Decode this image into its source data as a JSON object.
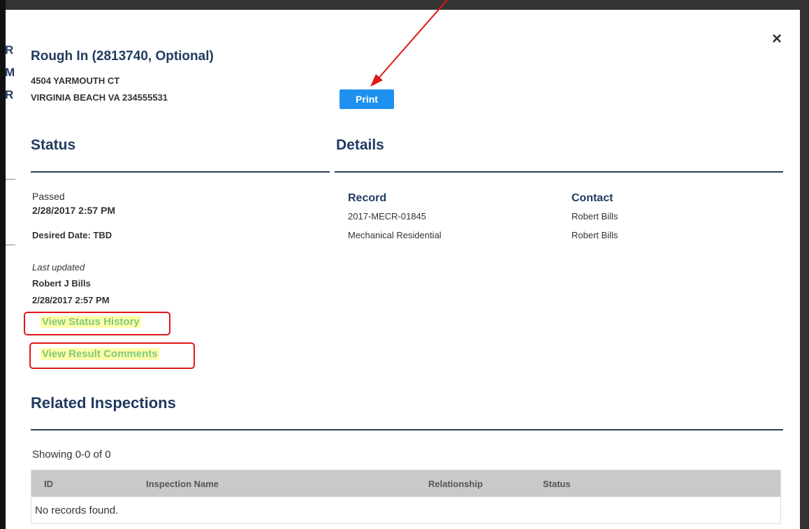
{
  "modal": {
    "title": "Rough In (2813740, Optional)",
    "address_line1": "4504 YARMOUTH CT",
    "address_line2": "VIRGINIA BEACH VA 234555531",
    "print_label": "Print",
    "close_symbol": "×"
  },
  "status": {
    "heading": "Status",
    "result": "Passed",
    "datetime": "2/28/2017 2:57 PM",
    "desired_date": "Desired Date: TBD",
    "last_updated_label": "Last updated",
    "updated_by": "Robert J Bills",
    "updated_datetime": "2/28/2017 2:57 PM",
    "view_status_history": "View Status History",
    "view_result_comments": "View Result Comments"
  },
  "details": {
    "heading": "Details",
    "record_label": "Record",
    "record_number": "2017-MECR-01845",
    "record_type": "Mechanical Residential",
    "contact_label": "Contact",
    "contact_line1": "Robert Bills",
    "contact_line2": "Robert Bills"
  },
  "related": {
    "heading": "Related Inspections",
    "showing": "Showing 0-0 of 0",
    "columns": [
      "ID",
      "Inspection Name",
      "Relationship",
      "Status"
    ],
    "empty_message": "No records found."
  },
  "background_page": {
    "fragments": [
      "R",
      "M",
      "R"
    ]
  },
  "colors": {
    "heading": "#1f3a5f",
    "print_button": "#1e90ef",
    "link": "#7fc97f",
    "link_highlight": "#ffffa8",
    "annotation": "#e01818"
  },
  "icons": {
    "close": "close-icon",
    "annotation_arrow": "arrow-icon"
  }
}
